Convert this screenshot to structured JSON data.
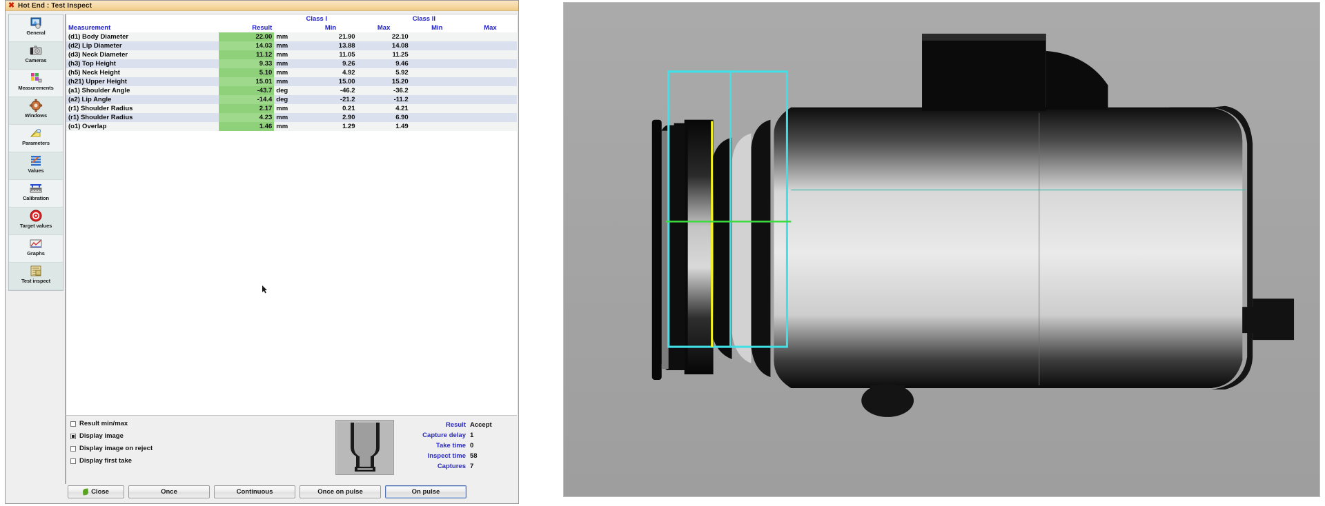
{
  "window": {
    "title": "Hot End : Test Inspect",
    "close_icon": "window-close-icon"
  },
  "sidebar": {
    "items": [
      {
        "label": "General",
        "icon": "general-icon"
      },
      {
        "label": "Cameras",
        "icon": "camera-icon"
      },
      {
        "label": "Measurements",
        "icon": "measurements-icon"
      },
      {
        "label": "Windows",
        "icon": "windows-gear-icon"
      },
      {
        "label": "Parameters",
        "icon": "parameters-icon"
      },
      {
        "label": "Values",
        "icon": "values-icon"
      },
      {
        "label": "Calibration",
        "icon": "calibration-icon"
      },
      {
        "label": "Target values",
        "icon": "target-icon"
      },
      {
        "label": "Graphs",
        "icon": "graphs-icon"
      },
      {
        "label": "Test inspect",
        "icon": "test-inspect-icon"
      }
    ],
    "selected": "Test inspect"
  },
  "table": {
    "group_headers": {
      "class1": "Class I",
      "class2": "Class II"
    },
    "columns": [
      "Measurement",
      "Result",
      "",
      "Min",
      "Max",
      "Min",
      "Max"
    ],
    "rows": [
      {
        "name": "(d1) Body Diameter",
        "result": "22.00",
        "unit": "mm",
        "c1min": "21.90",
        "c1max": "22.10",
        "c2min": "",
        "c2max": ""
      },
      {
        "name": "(d2) Lip Diameter",
        "result": "14.03",
        "unit": "mm",
        "c1min": "13.88",
        "c1max": "14.08",
        "c2min": "",
        "c2max": ""
      },
      {
        "name": "(d3) Neck Diameter",
        "result": "11.12",
        "unit": "mm",
        "c1min": "11.05",
        "c1max": "11.25",
        "c2min": "",
        "c2max": ""
      },
      {
        "name": "(h3) Top Height",
        "result": "9.33",
        "unit": "mm",
        "c1min": "9.26",
        "c1max": "9.46",
        "c2min": "",
        "c2max": ""
      },
      {
        "name": "(h5) Neck Height",
        "result": "5.10",
        "unit": "mm",
        "c1min": "4.92",
        "c1max": "5.92",
        "c2min": "",
        "c2max": ""
      },
      {
        "name": "(h21) Upper Height",
        "result": "15.01",
        "unit": "mm",
        "c1min": "15.00",
        "c1max": "15.20",
        "c2min": "",
        "c2max": ""
      },
      {
        "name": "(a1) Shoulder Angle",
        "result": "-43.7",
        "unit": "deg",
        "c1min": "-46.2",
        "c1max": "-36.2",
        "c2min": "",
        "c2max": ""
      },
      {
        "name": "(a2) Lip Angle",
        "result": "-14.4",
        "unit": "deg",
        "c1min": "-21.2",
        "c1max": "-11.2",
        "c2min": "",
        "c2max": ""
      },
      {
        "name": "(r1) Shoulder Radius",
        "result": "2.17",
        "unit": "mm",
        "c1min": "0.21",
        "c1max": "4.21",
        "c2min": "",
        "c2max": ""
      },
      {
        "name": "(r1) Shoulder Radius",
        "result": "4.23",
        "unit": "mm",
        "c1min": "2.90",
        "c1max": "6.90",
        "c2min": "",
        "c2max": ""
      },
      {
        "name": "(o1) Overlap",
        "result": "1.46",
        "unit": "mm",
        "c1min": "1.29",
        "c1max": "1.49",
        "c2min": "",
        "c2max": ""
      }
    ]
  },
  "options": [
    {
      "label": "Result min/max",
      "checked": false
    },
    {
      "label": "Display image",
      "checked": true
    },
    {
      "label": "Display image on reject",
      "checked": false
    },
    {
      "label": "Display first take",
      "checked": false
    }
  ],
  "stats": [
    {
      "label": "Result",
      "value": "Accept"
    },
    {
      "label": "Capture delay",
      "value": "1"
    },
    {
      "label": "Take time",
      "value": "0"
    },
    {
      "label": "Inspect time",
      "value": "58"
    },
    {
      "label": "Captures",
      "value": "7"
    }
  ],
  "buttons": {
    "close": "Close",
    "once": "Once",
    "continuous": "Continuous",
    "once_on_pulse": "Once on pulse",
    "on_pulse": "On pulse"
  },
  "colors": {
    "result_cell": "#8fd07a",
    "header_text": "#2020c8",
    "roi_cyan": "#3fe0e8",
    "axis_yellow": "#f5f11a",
    "measure_green": "#3ddc3d",
    "titlebar": "#f6d9a4"
  }
}
